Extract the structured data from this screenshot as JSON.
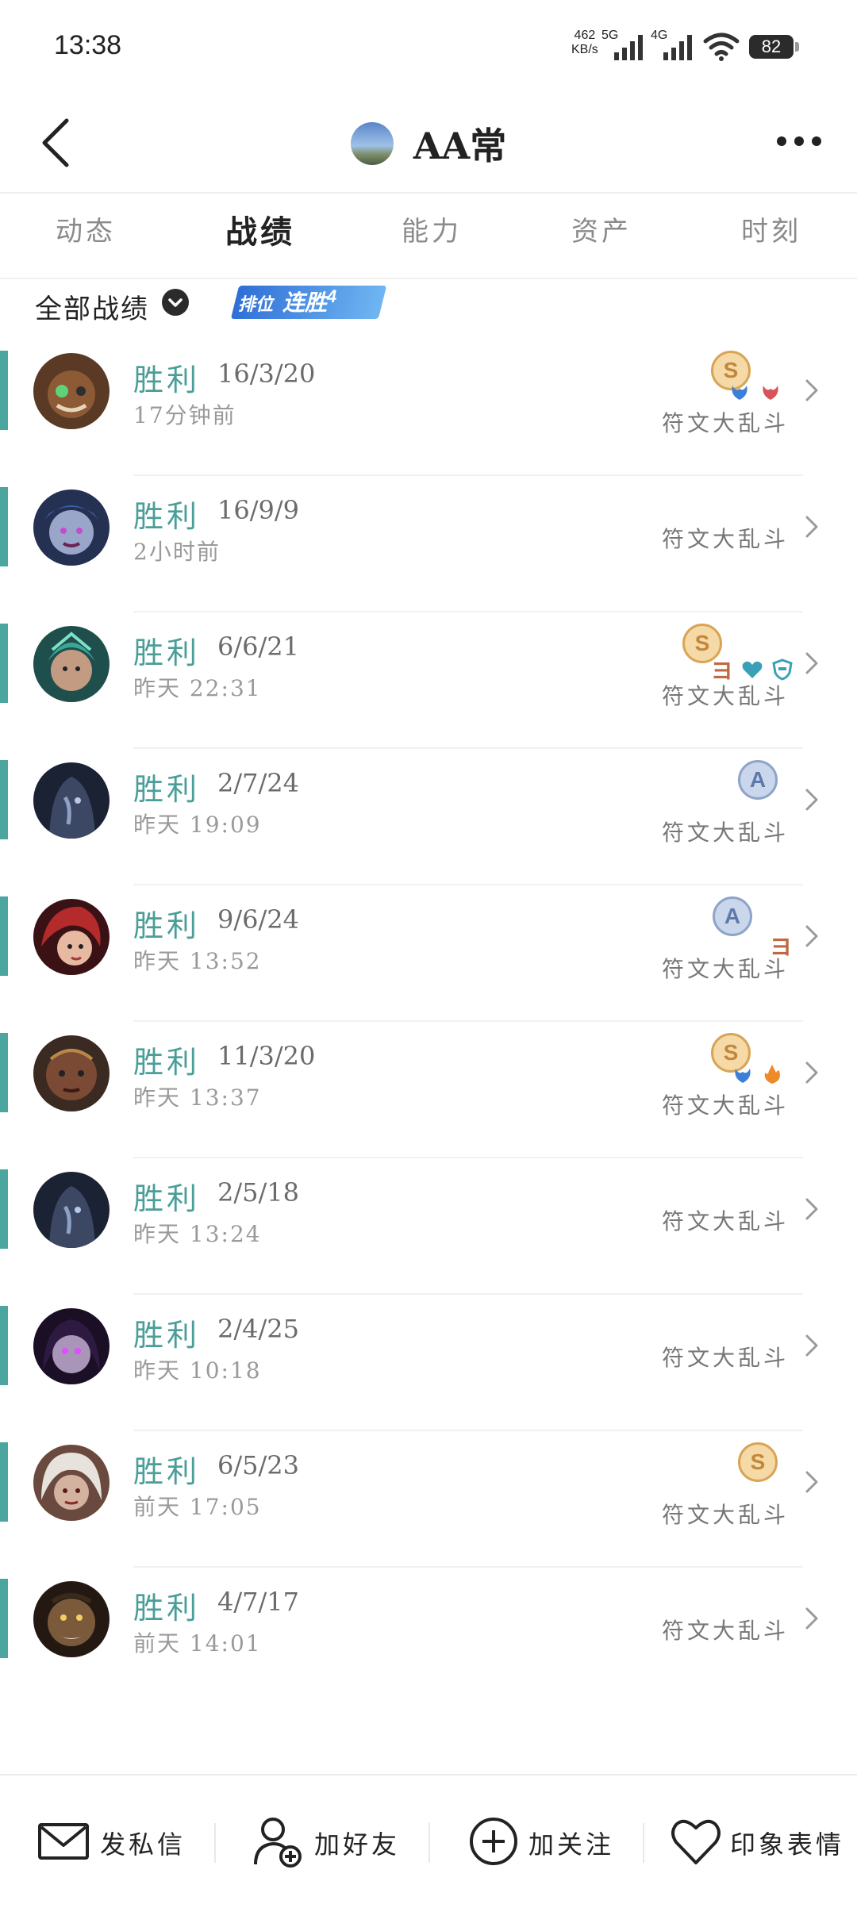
{
  "status_bar": {
    "time": "13:38",
    "net_speed_value": "462",
    "net_speed_unit": "KB/s",
    "sim1_label": "5G",
    "sim2_label": "4G",
    "battery": "82"
  },
  "header": {
    "title": "AA常"
  },
  "tabs": [
    {
      "label": "动态",
      "active": false
    },
    {
      "label": "战绩",
      "active": true
    },
    {
      "label": "能力",
      "active": false
    },
    {
      "label": "资产",
      "active": false
    },
    {
      "label": "时刻",
      "active": false
    }
  ],
  "filter": {
    "label": "全部战绩",
    "streak_left": "排位",
    "streak_right": "连胜",
    "streak_count": "4"
  },
  "matches": [
    {
      "result": "胜利",
      "kda": "16/3/20",
      "time": "17分钟前",
      "mode": "符文大乱斗",
      "medal": "S",
      "badges": [
        "blue-flame",
        "red-flame"
      ]
    },
    {
      "result": "胜利",
      "kda": "16/9/9",
      "time": "2小时前",
      "mode": "符文大乱斗",
      "medal": "",
      "badges": []
    },
    {
      "result": "胜利",
      "kda": "6/6/21",
      "time": "昨天 22:31",
      "mode": "符文大乱斗",
      "medal": "S",
      "badges": [
        "three",
        "heart",
        "shield"
      ]
    },
    {
      "result": "胜利",
      "kda": "2/7/24",
      "time": "昨天 19:09",
      "mode": "符文大乱斗",
      "medal": "A",
      "badges": []
    },
    {
      "result": "胜利",
      "kda": "9/6/24",
      "time": "昨天 13:52",
      "mode": "符文大乱斗",
      "medal": "A",
      "badges": [
        "three"
      ]
    },
    {
      "result": "胜利",
      "kda": "11/3/20",
      "time": "昨天 13:37",
      "mode": "符文大乱斗",
      "medal": "S",
      "badges": [
        "blue-flame",
        "orange-flame"
      ]
    },
    {
      "result": "胜利",
      "kda": "2/5/18",
      "time": "昨天 13:24",
      "mode": "符文大乱斗",
      "medal": "",
      "badges": []
    },
    {
      "result": "胜利",
      "kda": "2/4/25",
      "time": "昨天 10:18",
      "mode": "符文大乱斗",
      "medal": "",
      "badges": []
    },
    {
      "result": "胜利",
      "kda": "6/5/23",
      "time": "前天 17:05",
      "mode": "符文大乱斗",
      "medal": "S",
      "badges": []
    },
    {
      "result": "胜利",
      "kda": "4/7/17",
      "time": "前天 14:01",
      "mode": "符文大乱斗",
      "medal": "",
      "badges": []
    }
  ],
  "bottom_bar": [
    {
      "label": "发私信",
      "icon": "mail-icon"
    },
    {
      "label": "加好友",
      "icon": "add-friend-icon"
    },
    {
      "label": "加关注",
      "icon": "add-follow-icon"
    },
    {
      "label": "印象表情",
      "icon": "heart-icon"
    }
  ],
  "colors": {
    "win_accent": "#4aa69f",
    "win_text": "#4a9e98",
    "medal_s": "#d9a455",
    "medal_a": "#8ea4c8"
  }
}
